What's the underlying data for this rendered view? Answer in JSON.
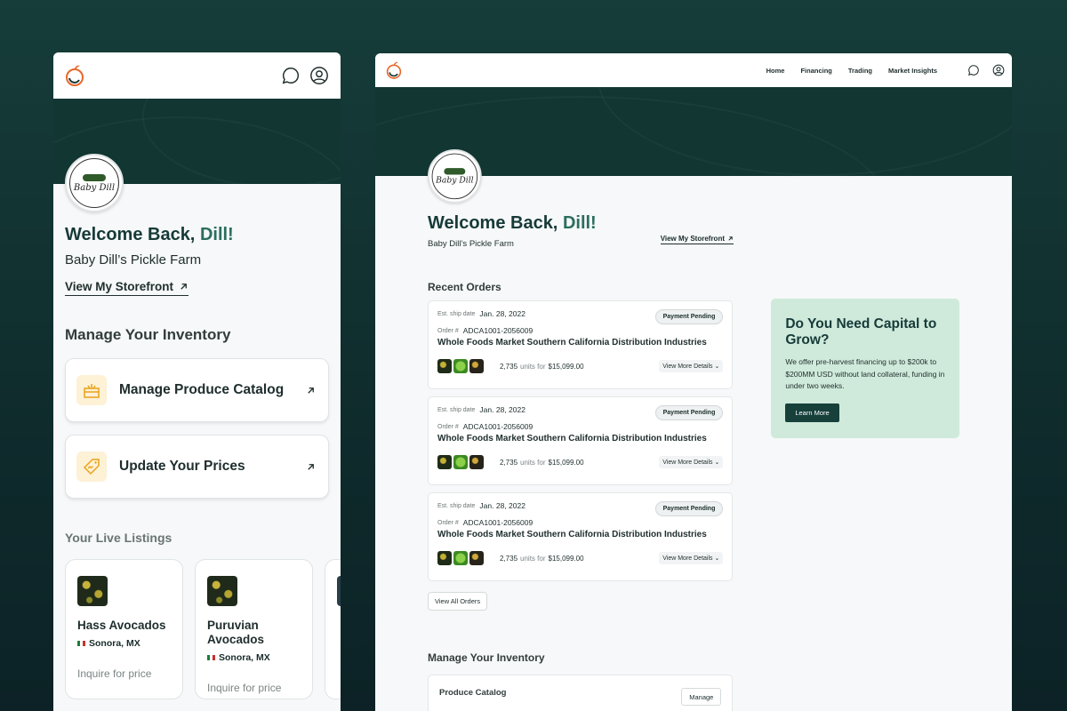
{
  "user": {
    "greeting": "Welcome Back, ",
    "name": "Dill!",
    "farm": "Baby Dill’s Pickle Farm",
    "logo_text": "Baby Dill"
  },
  "storefront_link": "View My Storefront",
  "nav": {
    "items": [
      "Home",
      "Financing",
      "Trading",
      "Market Insights"
    ]
  },
  "mobile": {
    "inventory_title": "Manage Your Inventory",
    "cards": [
      {
        "label": "Manage Produce Catalog",
        "icon": "crate-icon"
      },
      {
        "label": "Update Your Prices",
        "icon": "price-tag-icon"
      }
    ],
    "live_title": "Your Live Listings",
    "listings": [
      {
        "name": "Hass Avocados",
        "location": "Sonora, MX",
        "price": "Inquire for price"
      },
      {
        "name": "Puruvian Avocados",
        "location": "Sonora, MX",
        "price": "Inquire for price"
      }
    ]
  },
  "recent_orders": {
    "title": "Recent Orders",
    "ship_label": "Est. ship date",
    "order_label": "Order #",
    "units_for": "units for",
    "details_label": "View More Details",
    "orders": [
      {
        "ship_date": "Jan. 28, 2022",
        "status": "Payment Pending",
        "number": "ADCA1001-2056009",
        "customer": "Whole Foods Market Southern California Distribution Industries",
        "units": "2,735",
        "amount": "$15,099.00"
      },
      {
        "ship_date": "Jan. 28, 2022",
        "status": "Payment Pending",
        "number": "ADCA1001-2056009",
        "customer": "Whole Foods Market Southern California Distribution Industries",
        "units": "2,735",
        "amount": "$15,099.00"
      },
      {
        "ship_date": "Jan. 28, 2022",
        "status": "Payment Pending",
        "number": "ADCA1001-2056009",
        "customer": "Whole Foods Market Southern California Distribution Industries",
        "units": "2,735",
        "amount": "$15,099.00"
      }
    ],
    "view_all": "View All Orders"
  },
  "inventory": {
    "title": "Manage Your Inventory",
    "catalog_title": "Produce Catalog",
    "manage_label": "Manage"
  },
  "promo": {
    "title": "Do You Need Capital to Grow?",
    "body": "We offer pre-harvest financing up to $200k to $200MM USD without land collateral, funding in under two weeks.",
    "cta": "Learn More"
  },
  "colors": {
    "brand_dark": "#123733",
    "accent": "#2b6e5e",
    "promo_bg": "#cfeadb",
    "icon_bg": "#fdf1d6",
    "icon_color": "#e8a31a"
  }
}
